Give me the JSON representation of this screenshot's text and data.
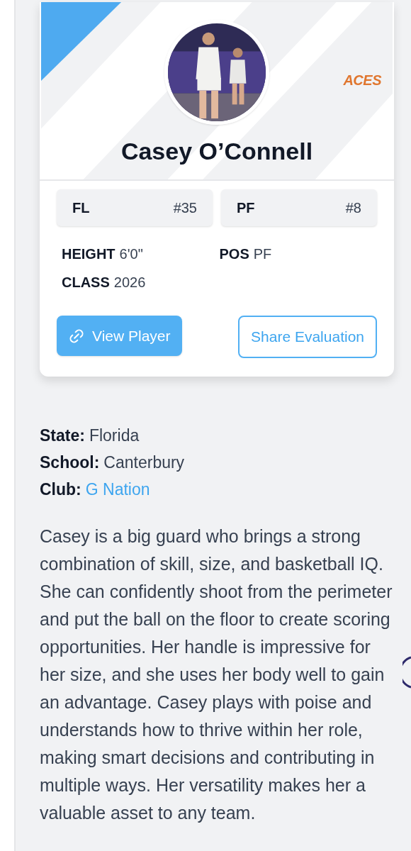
{
  "player": {
    "name": "Casey O’Connell",
    "logo": "ACES"
  },
  "badges": [
    {
      "label": "FL",
      "number": "#35"
    },
    {
      "label": "PF",
      "number": "#8"
    }
  ],
  "stats": [
    {
      "label": "HEIGHT",
      "value": "6'0\""
    },
    {
      "label": "POS",
      "value": "PF"
    },
    {
      "label": "CLASS",
      "value": "2026"
    }
  ],
  "buttons": [
    {
      "kind": "primary",
      "label": "View Player"
    },
    {
      "kind": "outline",
      "label": "Share Evaluation"
    }
  ],
  "details": [
    {
      "label": "State:",
      "value": "Florida",
      "kind": "text"
    },
    {
      "label": "School:",
      "value": "Canterbury",
      "kind": "text"
    },
    {
      "label": "Club:",
      "value": "G Nation",
      "kind": "link"
    }
  ],
  "bio": "Casey is a big guard who brings a strong combination of skill, size, and basketball IQ. She can confidently shoot from the perimeter and put the ball on the floor to create scoring opportunities. Her handle is impressive for her size, and she uses her body well to gain an advantage. Casey plays with poise and understands how to thrive within her role, making smart decisions and contributing in multiple ways. Her versatility makes her a valuable asset to any team."
}
